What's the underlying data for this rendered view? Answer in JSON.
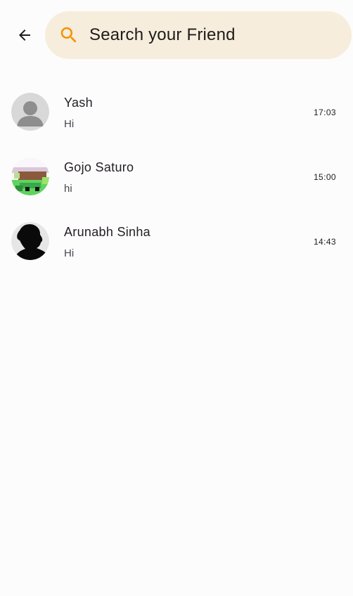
{
  "header": {
    "back_icon": "arrow-left-icon",
    "search_icon": "search-icon",
    "search_icon_color": "#f39200",
    "search_placeholder": "Search your Friend",
    "search_bg": "#f6eddd"
  },
  "chats": [
    {
      "name": "Yash",
      "message": "Hi",
      "time": "17:03",
      "avatar": "default-person-avatar"
    },
    {
      "name": "Gojo Saturo",
      "message": "hi",
      "time": "15:00",
      "avatar": "pixel-art-avatar"
    },
    {
      "name": "Arunabh Sinha",
      "message": "Hi",
      "time": "14:43",
      "avatar": "silhouette-photo-avatar"
    }
  ]
}
